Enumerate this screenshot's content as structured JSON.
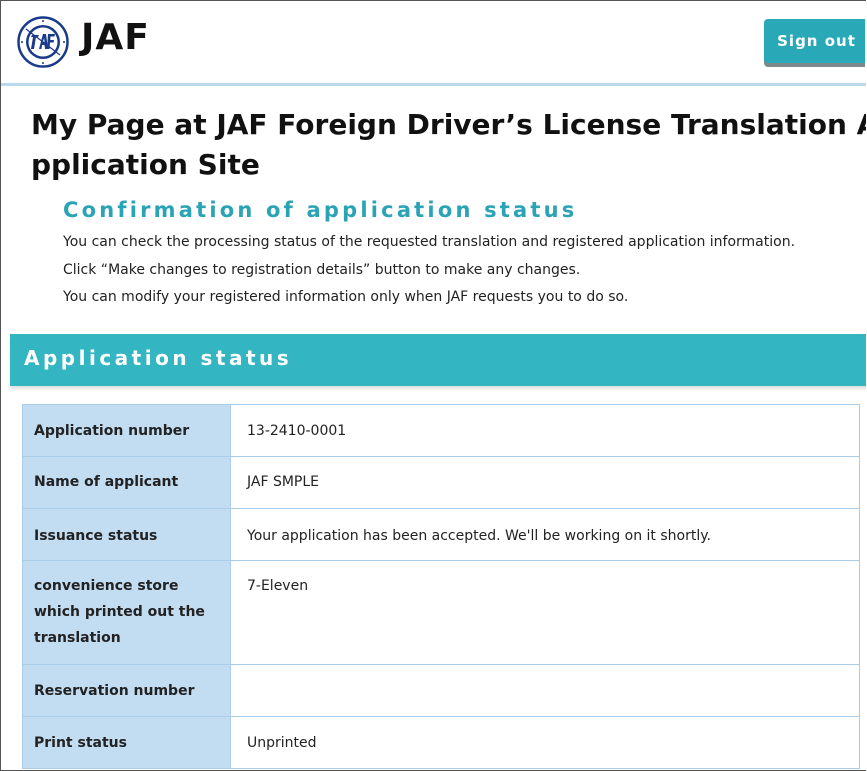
{
  "header": {
    "logo_text": "JAF",
    "sign_out_label": "Sign out"
  },
  "page": {
    "title": "My Page at JAF Foreign Driver’s License Translation Application Site",
    "subtitle": "Confirmation of application status",
    "descriptions": [
      "You can check the processing status of the requested translation and registered application information.",
      "Click “Make changes to registration details” button to make any changes.",
      "You can modify your registered information only when JAF requests you to do so."
    ]
  },
  "status_section": {
    "title": "Application status",
    "rows": [
      {
        "label": "Application number",
        "value": "13-2410-0001"
      },
      {
        "label": "Name of applicant",
        "value": "JAF SMPLE"
      },
      {
        "label": "Issuance status",
        "value": "Your application has been accepted. We'll be working on it shortly."
      },
      {
        "label": "convenience store which printed out the translation",
        "value": "7-Eleven"
      },
      {
        "label": "Reservation number",
        "value": ""
      },
      {
        "label": "Print status",
        "value": "Unprinted"
      }
    ]
  },
  "colors": {
    "accent": "#33b5c2",
    "subtitle": "#2aa3b5",
    "header_cell": "#c2dcf1",
    "border": "#a9cde6"
  },
  "icons": {
    "logo": "jaf-emblem-icon"
  }
}
